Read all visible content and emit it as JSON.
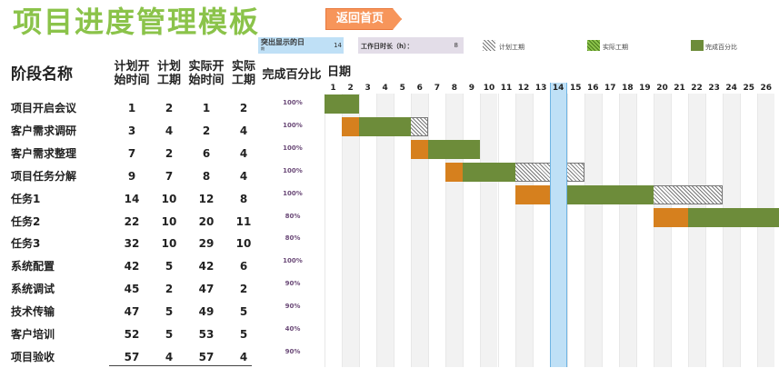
{
  "title": "项目进度管理模板",
  "back_button": "返回首页",
  "highlight": {
    "label": "突出显示的日",
    "sub": "期",
    "value": "14"
  },
  "workdays": {
    "label": "工作日时长（h）：",
    "value": "8"
  },
  "legend": [
    {
      "label": "计划工期",
      "style": "hatch"
    },
    {
      "label": "实际工期",
      "style": "hatch-g"
    },
    {
      "label": "完成百分比",
      "style": "solid"
    }
  ],
  "headers": {
    "name": "阶段名称",
    "plan_start": [
      "计划开",
      "始时间"
    ],
    "plan_dur": [
      "计划",
      "工期"
    ],
    "act_start": [
      "实际开",
      "始时间"
    ],
    "act_dur": [
      "实际",
      "工期"
    ],
    "pct": "完成百分比",
    "date": "日期"
  },
  "days": [
    "1",
    "2",
    "3",
    "4",
    "5",
    "6",
    "7",
    "8",
    "9",
    "10",
    "11",
    "12",
    "13",
    "14",
    "15",
    "16",
    "17",
    "18",
    "19",
    "20",
    "21",
    "22",
    "23",
    "24",
    "25",
    "26"
  ],
  "highlight_day": 14,
  "colors": {
    "title": "#8bc34a",
    "orange": "#d6801e",
    "green": "#6d8c3a",
    "highlight": "#bfe0f6"
  },
  "tasks": [
    {
      "name": "项目开启会议",
      "plan_start": "1",
      "plan_dur": "2",
      "act_start": "1",
      "act_dur": "2",
      "pct": "100%"
    },
    {
      "name": "客户需求调研",
      "plan_start": "3",
      "plan_dur": "4",
      "act_start": "2",
      "act_dur": "4",
      "pct": "100%"
    },
    {
      "name": "客户需求整理",
      "plan_start": "7",
      "plan_dur": "2",
      "act_start": "6",
      "act_dur": "4",
      "pct": "100%"
    },
    {
      "name": "项目任务分解",
      "plan_start": "9",
      "plan_dur": "7",
      "act_start": "8",
      "act_dur": "4",
      "pct": "100%"
    },
    {
      "name": "任务1",
      "plan_start": "14",
      "plan_dur": "10",
      "act_start": "12",
      "act_dur": "8",
      "pct": "100%"
    },
    {
      "name": "任务2",
      "plan_start": "22",
      "plan_dur": "10",
      "act_start": "20",
      "act_dur": "11",
      "pct": "80%"
    },
    {
      "name": "任务3",
      "plan_start": "32",
      "plan_dur": "10",
      "act_start": "29",
      "act_dur": "10",
      "pct": "80%"
    },
    {
      "name": "系统配置",
      "plan_start": "42",
      "plan_dur": "5",
      "act_start": "42",
      "act_dur": "6",
      "pct": "100%"
    },
    {
      "name": "系统调试",
      "plan_start": "45",
      "plan_dur": "2",
      "act_start": "47",
      "act_dur": "2",
      "pct": "90%"
    },
    {
      "name": "技术传输",
      "plan_start": "47",
      "plan_dur": "5",
      "act_start": "49",
      "act_dur": "5",
      "pct": "90%"
    },
    {
      "name": "客户培训",
      "plan_start": "52",
      "plan_dur": "5",
      "act_start": "53",
      "act_dur": "5",
      "pct": "40%"
    },
    {
      "name": "项目验收",
      "plan_start": "57",
      "plan_dur": "4",
      "act_start": "57",
      "act_dur": "4",
      "pct": "90%"
    }
  ]
}
